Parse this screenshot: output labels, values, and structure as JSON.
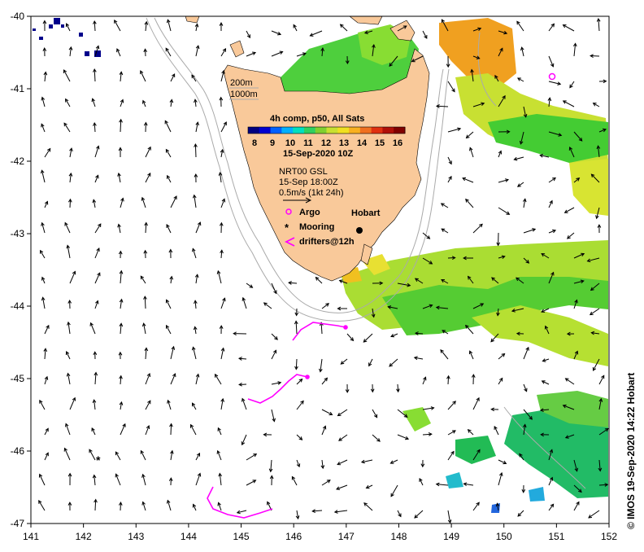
{
  "axes": {
    "lon_ticks": [
      "141",
      "142",
      "143",
      "144",
      "145",
      "146",
      "147",
      "148",
      "149",
      "150",
      "151",
      "152"
    ],
    "lat_ticks": [
      "-40",
      "-41",
      "-42",
      "-43",
      "-44",
      "-45",
      "-46",
      "-47"
    ]
  },
  "depth_labels": {
    "contour_200": "200m",
    "contour_1000": "1000m"
  },
  "sst_legend": {
    "title": "4h comp, p50, All Sats",
    "scale_labels": [
      "8",
      "9",
      "10",
      "11",
      "12",
      "13",
      "14",
      "15",
      "16"
    ],
    "date": "15-Sep-2020 10Z"
  },
  "current_legend": {
    "source": "NRT00 GSL",
    "time": "15-Sep 18:00Z",
    "scale": "0.5m/s (1kt 24h)"
  },
  "places": {
    "hobart": "Hobart"
  },
  "symbol_legend": {
    "argo": "Argo",
    "mooring": "Mooring",
    "drifters": "drifters@12h"
  },
  "credit": "© IMOS 19-Sep-2020 14:22 Hobart",
  "colors": {
    "land": "#f9c99a",
    "sst_cold": "#00008b",
    "sst_green": "#33cc33",
    "sst_yellow": "#c8e632",
    "sst_orange": "#f5a020",
    "drifter": "#ff00ff",
    "contour": "#aaaaaa"
  }
}
